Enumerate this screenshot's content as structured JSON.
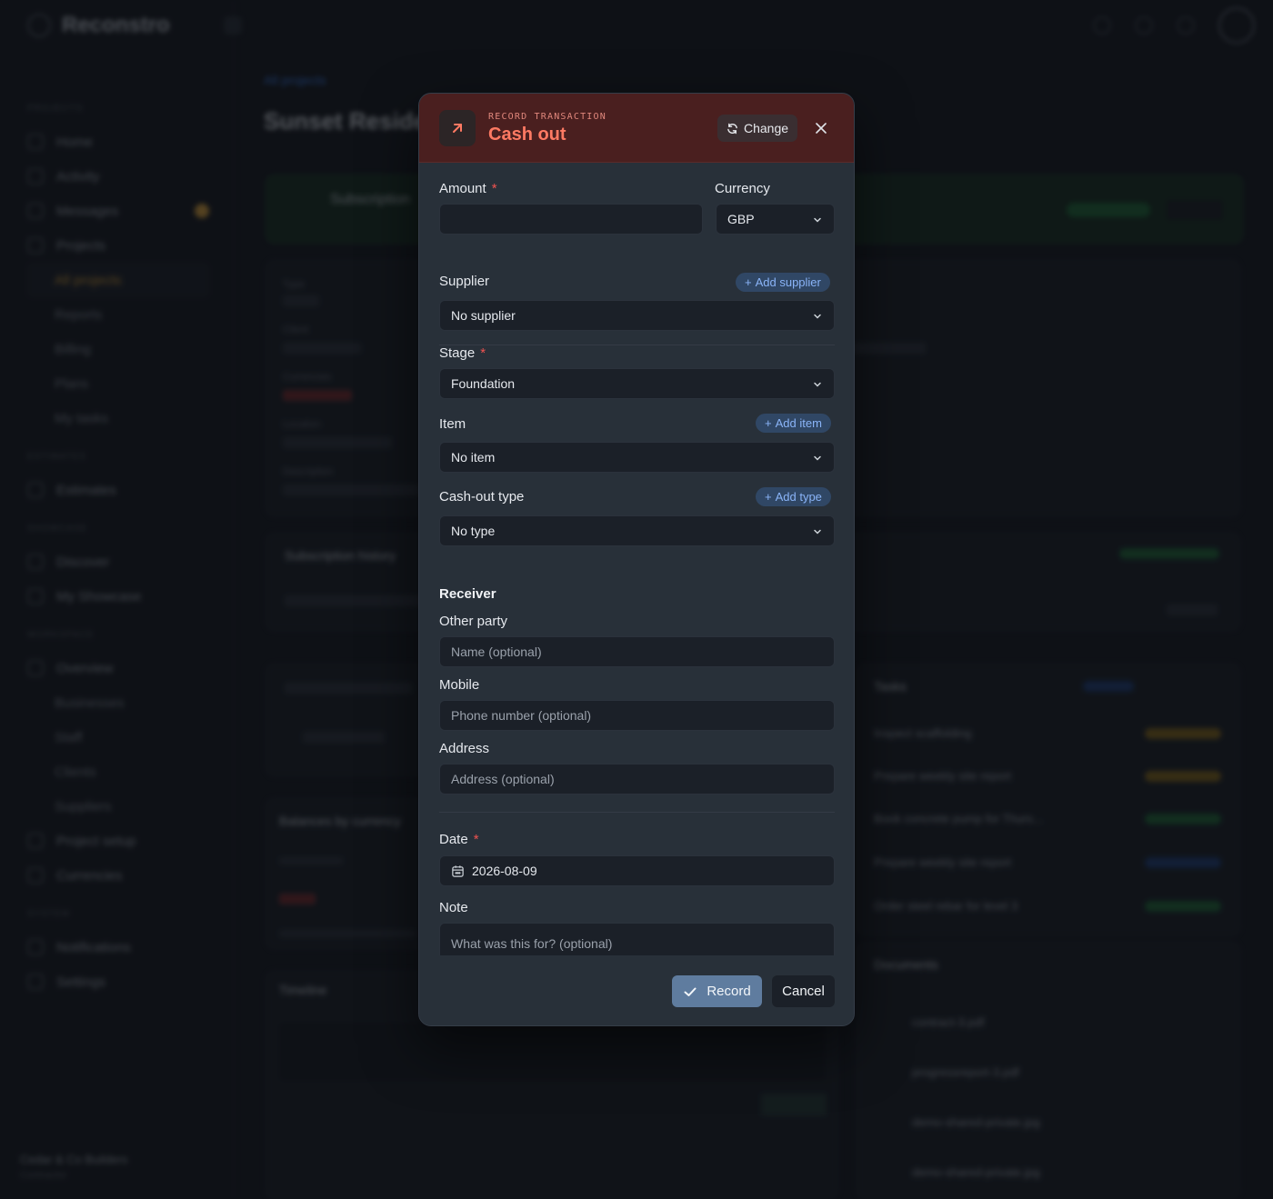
{
  "background": {
    "app_name": "Reconstro",
    "breadcrumb": "All projects",
    "page_title": "Sunset Reside",
    "sidebar_sections": [
      "PROJECTS",
      "ESTIMATES",
      "SHOWCASE",
      "WORKSPACE",
      "SYSTEM"
    ],
    "sidebar_items": [
      "Home",
      "Activity",
      "Messages",
      "Projects",
      "All projects",
      "Reports",
      "Billing",
      "Plans",
      "My tasks",
      "Estimates",
      "Discover",
      "My Showcase",
      "Overview",
      "Businesses",
      "Staff",
      "Clients",
      "Suppliers",
      "Project setup",
      "Currencies",
      "Notifications",
      "Settings"
    ],
    "company": "Cedar & Co Builders",
    "company_role": "Contractor",
    "card_labels": [
      "Subscription",
      "Type",
      "Client",
      "Currencies",
      "Location",
      "Description",
      "Subscription history",
      "Balances by currency",
      "Timeline",
      "Tasks",
      "Documents"
    ],
    "tasks": [
      "Inspect scaffolding",
      "Prepare weekly site report",
      "Book concrete pump for Thurs...",
      "Prepare weekly site report",
      "Order steel rebar for level 3"
    ],
    "documents": [
      "contract-3.pdf",
      "progressreport-3.pdf",
      "demo-shared-private.jpg",
      "demo-shared-private.jpg"
    ]
  },
  "modal": {
    "kicker": "RECORD TRANSACTION",
    "title": "Cash out",
    "change_label": "Change",
    "amount": {
      "label": "Amount",
      "value": ""
    },
    "currency": {
      "label": "Currency",
      "value": "GBP"
    },
    "supplier": {
      "label": "Supplier",
      "value": "No supplier",
      "add_label": "Add supplier"
    },
    "stage": {
      "label": "Stage",
      "value": "Foundation"
    },
    "item": {
      "label": "Item",
      "value": "No item",
      "add_label": "Add item"
    },
    "cashout_type": {
      "label": "Cash-out type",
      "value": "No type",
      "add_label": "Add type"
    },
    "receiver": {
      "title": "Receiver",
      "other_party_label": "Other party",
      "other_party_placeholder": "Name (optional)",
      "mobile_label": "Mobile",
      "mobile_placeholder": "Phone number (optional)",
      "address_label": "Address",
      "address_placeholder": "Address (optional)"
    },
    "date": {
      "label": "Date",
      "value": "2026-08-09"
    },
    "note": {
      "label": "Note",
      "placeholder": "What was this for? (optional)"
    },
    "record_label": "Record",
    "cancel_label": "Cancel",
    "required_mark": "*",
    "colors": {
      "header_bg": "#4a1f1f",
      "accent": "#ff7a63",
      "record_bg": "#5f7c9f",
      "add_pill": "#8ab4f8"
    }
  }
}
